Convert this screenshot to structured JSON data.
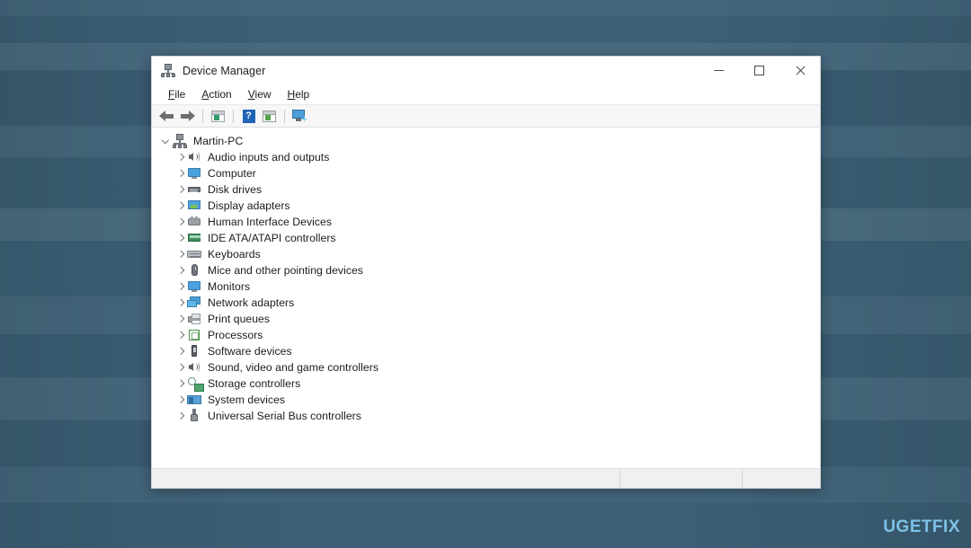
{
  "window": {
    "title": "Device Manager",
    "title_icon": "device-manager-icon",
    "caption": {
      "minimize": "–",
      "maximize": "□",
      "close": "✕",
      "minimize_name": "minimize-button",
      "maximize_name": "maximize-button",
      "close_name": "close-button"
    }
  },
  "menubar": {
    "items": [
      {
        "accesskey": "F",
        "rest": "ile",
        "full": "File",
        "name": "menu-file"
      },
      {
        "accesskey": "A",
        "rest": "ction",
        "full": "Action",
        "name": "menu-action"
      },
      {
        "accesskey": "V",
        "rest": "iew",
        "full": "View",
        "name": "menu-view"
      },
      {
        "accesskey": "H",
        "rest": "elp",
        "full": "Help",
        "name": "menu-help"
      }
    ]
  },
  "toolbar": {
    "buttons": [
      {
        "icon": "back-arrow-icon",
        "label": "Back"
      },
      {
        "icon": "forward-arrow-icon",
        "label": "Forward"
      },
      {
        "icon": "properties-icon",
        "label": "Properties"
      },
      {
        "icon": "help-icon",
        "label": "Help"
      },
      {
        "icon": "update-driver-icon",
        "label": "Update driver"
      },
      {
        "icon": "scan-hardware-icon",
        "label": "Scan for hardware changes"
      }
    ],
    "help_glyph": "?"
  },
  "tree": {
    "root": {
      "label": "Martin-PC",
      "icon": "computer-tree-icon",
      "expanded": true
    },
    "items": [
      {
        "label": "Audio inputs and outputs",
        "icon": "audio-icon"
      },
      {
        "label": "Computer",
        "icon": "computer-icon"
      },
      {
        "label": "Disk drives",
        "icon": "disk-drive-icon"
      },
      {
        "label": "Display adapters",
        "icon": "display-adapter-icon"
      },
      {
        "label": "Human Interface Devices",
        "icon": "hid-icon"
      },
      {
        "label": "IDE ATA/ATAPI controllers",
        "icon": "ide-controller-icon"
      },
      {
        "label": "Keyboards",
        "icon": "keyboard-icon"
      },
      {
        "label": "Mice and other pointing devices",
        "icon": "mouse-icon"
      },
      {
        "label": "Monitors",
        "icon": "monitor-icon"
      },
      {
        "label": "Network adapters",
        "icon": "network-adapter-icon"
      },
      {
        "label": "Print queues",
        "icon": "printer-icon"
      },
      {
        "label": "Processors",
        "icon": "processor-icon"
      },
      {
        "label": "Software devices",
        "icon": "software-device-icon"
      },
      {
        "label": "Sound, video and game controllers",
        "icon": "sound-video-icon"
      },
      {
        "label": "Storage controllers",
        "icon": "storage-controller-icon"
      },
      {
        "label": "System devices",
        "icon": "system-device-icon"
      },
      {
        "label": "Universal Serial Bus controllers",
        "icon": "usb-controller-icon"
      }
    ]
  },
  "statusbar": {
    "pane1": "",
    "pane2": "",
    "pane3": ""
  },
  "watermark": {
    "prefix": "UG",
    "stylized_letter": "E",
    "suffix": "TFIX",
    "full": "UGETFIX",
    "color": "#7ec2e8"
  },
  "colors": {
    "desktop": "#3e6279",
    "window_bg": "#ffffff",
    "toolbar_bg": "#f7f7f7",
    "statusbar_bg": "#f0f0f0",
    "accent_blue": "#1f64b5",
    "text": "#1b1b1b"
  }
}
